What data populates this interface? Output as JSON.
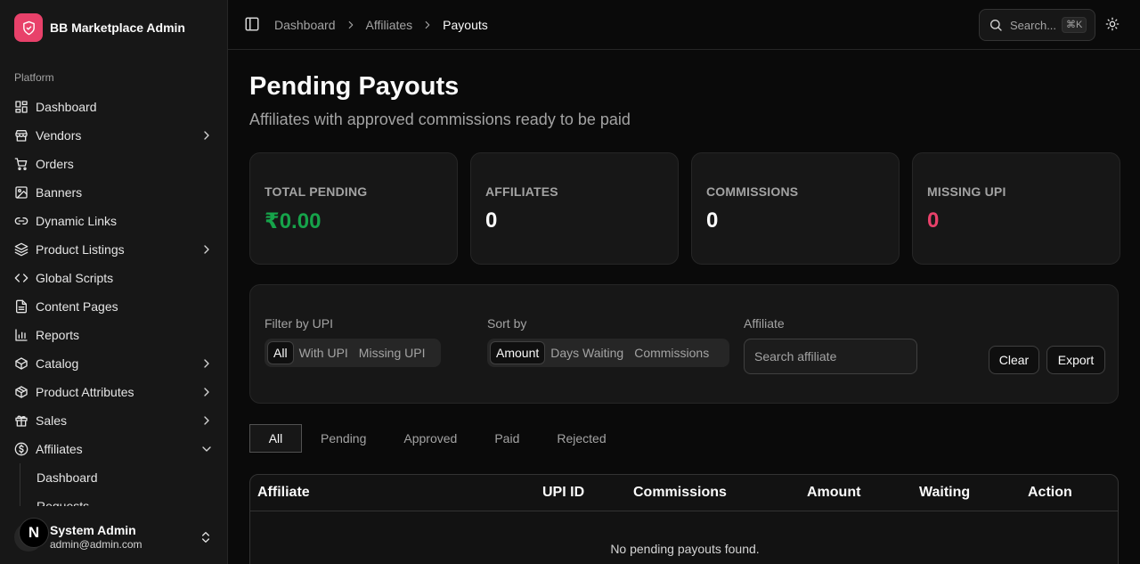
{
  "app": {
    "title": "BB Marketplace Admin"
  },
  "sidebar": {
    "group_label": "Platform",
    "items": [
      {
        "label": "Dashboard",
        "icon": "layout-dashboard-icon"
      },
      {
        "label": "Vendors",
        "icon": "store-icon"
      },
      {
        "label": "Orders",
        "icon": "shopping-cart-icon"
      },
      {
        "label": "Banners",
        "icon": "image-icon"
      },
      {
        "label": "Dynamic Links",
        "icon": "link-icon"
      },
      {
        "label": "Product Listings",
        "icon": "layers-icon"
      },
      {
        "label": "Global Scripts",
        "icon": "code-icon"
      },
      {
        "label": "Content Pages",
        "icon": "file-text-icon"
      },
      {
        "label": "Reports",
        "icon": "bar-chart-icon"
      },
      {
        "label": "Catalog",
        "icon": "package-icon"
      },
      {
        "label": "Product Attributes",
        "icon": "box-icon"
      },
      {
        "label": "Sales",
        "icon": "gift-icon"
      },
      {
        "label": "Affiliates",
        "icon": "dollar-circle-icon"
      }
    ],
    "affiliates_sub": [
      {
        "label": "Dashboard"
      },
      {
        "label": "Requests"
      }
    ],
    "user": {
      "initial": "N",
      "name": "System Admin",
      "email": "admin@admin.com"
    }
  },
  "header": {
    "breadcrumb": [
      "Dashboard",
      "Affiliates",
      "Payouts"
    ],
    "search_label": "Search...",
    "search_shortcut": "⌘K"
  },
  "main": {
    "title": "Pending Payouts",
    "subtitle": "Affiliates with approved commissions ready to be paid",
    "stats": [
      {
        "label": "TOTAL PENDING",
        "value": "₹0.00",
        "color": "#16a34a"
      },
      {
        "label": "AFFILIATES",
        "value": "0",
        "color": "#fafafa"
      },
      {
        "label": "COMMISSIONS",
        "value": "0",
        "color": "#fafafa"
      },
      {
        "label": "MISSING UPI",
        "value": "0",
        "color": "#e8416a"
      }
    ],
    "filters": {
      "upi_label": "Filter by UPI",
      "upi_options": [
        "All",
        "With UPI",
        "Missing UPI"
      ],
      "sort_label": "Sort by",
      "sort_options": [
        "Amount",
        "Days Waiting",
        "Commissions"
      ],
      "affiliate_label": "Affiliate",
      "affiliate_placeholder": "Search affiliate",
      "clear_label": "Clear",
      "export_label": "Export"
    },
    "tabs": [
      "All",
      "Pending",
      "Approved",
      "Paid",
      "Rejected"
    ],
    "table": {
      "columns": [
        "Affiliate",
        "UPI ID",
        "Commissions",
        "Amount",
        "Waiting",
        "Action"
      ],
      "empty_text": "No pending payouts found."
    }
  }
}
